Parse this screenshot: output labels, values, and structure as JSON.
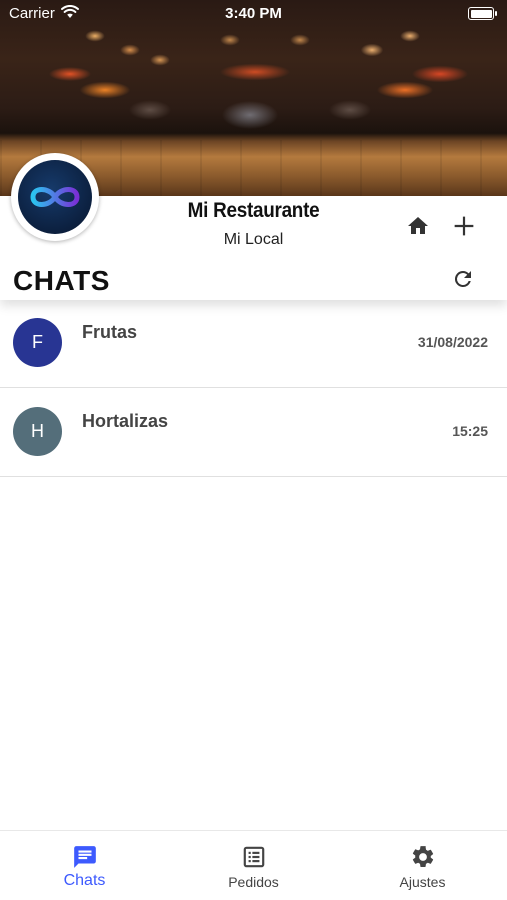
{
  "status_bar": {
    "carrier": "Carrier",
    "time": "3:40 PM"
  },
  "profile": {
    "name": "Mi Restaurante",
    "location": "Mi Local"
  },
  "section": {
    "title": "CHATS"
  },
  "chats": [
    {
      "initial": "F",
      "name": "Frutas",
      "timestamp": "31/08/2022",
      "avatar_color": "#283593"
    },
    {
      "initial": "H",
      "name": "Hortalizas",
      "timestamp": "15:25",
      "avatar_color": "#546e7a"
    }
  ],
  "bottom_nav": {
    "active_color": "#3d5afe",
    "items": [
      {
        "label": "Chats",
        "icon": "chat-icon"
      },
      {
        "label": "Pedidos",
        "icon": "list-icon"
      },
      {
        "label": "Ajustes",
        "icon": "gear-icon"
      }
    ]
  }
}
